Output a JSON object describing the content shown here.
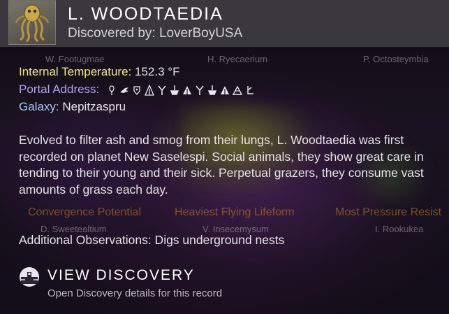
{
  "header": {
    "title": "L. WOODTAEDIA",
    "discovered_by": "Discovered by: LoverBoyUSA",
    "thumbnail_icon": "squid-creature-icon"
  },
  "background_labels": {
    "row1": [
      "W. Footugmae",
      "H. Ryecaerium",
      "P. Octosteymbia"
    ],
    "row2": [
      "Convergence Potential",
      "Heaviest Flying Lifeform",
      "Most Pressure Resist"
    ],
    "row3": [
      "D. Sweetealtium",
      "V. Insecemysum",
      "I. Rookukea"
    ]
  },
  "stats": {
    "temperature_label": "Internal Temperature:",
    "temperature_value": "152.3 °F",
    "portal_label": "Portal Address:",
    "galaxy_label": "Galaxy:",
    "galaxy_value": "Nepitzaspru"
  },
  "portal_glyph_count": 12,
  "description": "Evolved to filter ash and smog from their lungs, L. Woodtaedia was first recorded on planet New Saselespi. Social animals, they show great care in tending to their young and their sick. Perpetual grazers, they consume vast amounts of grass each day.",
  "observations": "Additional Observations: Digs underground nests",
  "action": {
    "label": "VIEW DISCOVERY",
    "sublabel": "Open Discovery details for this record",
    "icon": "discovery-icon"
  },
  "colors": {
    "temperature": "#f2e58a",
    "portal": "#b59ff0",
    "galaxy": "#a9c6f0"
  }
}
